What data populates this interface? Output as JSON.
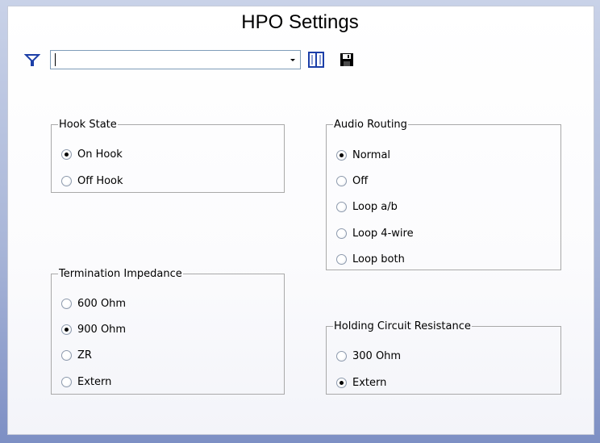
{
  "window": {
    "title": "HPO Settings"
  },
  "toolbar": {
    "filter_value": "",
    "icons": [
      "filter-icon",
      "dropdown-arrow-icon",
      "columns-icon",
      "save-icon"
    ]
  },
  "hook_state": {
    "legend": "Hook State",
    "options": [
      {
        "label": "On Hook",
        "checked": true
      },
      {
        "label": "Off Hook",
        "checked": false
      }
    ]
  },
  "audio_routing": {
    "legend": "Audio Routing",
    "options": [
      {
        "label": "Normal",
        "checked": true
      },
      {
        "label": "Off",
        "checked": false
      },
      {
        "label": "Loop a/b",
        "checked": false
      },
      {
        "label": "Loop 4-wire",
        "checked": false
      },
      {
        "label": "Loop both",
        "checked": false
      }
    ]
  },
  "termination_impedance": {
    "legend": "Termination Impedance",
    "options": [
      {
        "label": "600 Ohm",
        "checked": false
      },
      {
        "label": "900 Ohm",
        "checked": true
      },
      {
        "label": "ZR",
        "checked": false
      },
      {
        "label": "Extern",
        "checked": false
      }
    ]
  },
  "holding_circuit_resistance": {
    "legend": "Holding Circuit Resistance",
    "options": [
      {
        "label": "300 Ohm",
        "checked": false
      },
      {
        "label": "Extern",
        "checked": true
      }
    ]
  },
  "colors": {
    "border_gradient_bottom": "#7d8fc4",
    "icon_blue": "#1c3fa8"
  }
}
